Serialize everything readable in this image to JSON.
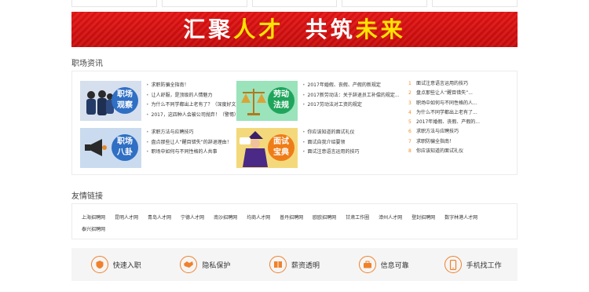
{
  "banner": {
    "part1": "汇聚",
    "part2": "人才",
    "part3": "共筑",
    "part4": "未来"
  },
  "career_news": {
    "title": "职场资讯",
    "blocks": [
      {
        "tag": "职场观察",
        "tag_line1": "职场",
        "tag_line2": "观察",
        "color": "#2f6fc4",
        "items": [
          "求职防骗全指南！",
          "让人舒服，是顶级的人情魅力",
          "为什么不同学都出上老有了？（深度好文）",
          "2017，这四种人会被公司抛弃！（警惕）"
        ]
      },
      {
        "tag": "劳动法规",
        "tag_line1": "劳动",
        "tag_line2": "法规",
        "color": "#1fa55b",
        "items": [
          "2017年婚假、丧假、产假的新规定",
          "2017新劳动法：关于辞退员工补偿的规定...",
          "2017劳动法对工资的规定"
        ]
      },
      {
        "tag": "职场八卦",
        "tag_line1": "职场",
        "tag_line2": "八卦",
        "color": "#2f6fc4",
        "items": [
          "求职方法与应聘技巧",
          "盘点那些让人“醒目错失”的辞退理由！",
          "职场中如何与不同性格的人共事"
        ]
      },
      {
        "tag": "面试宝典",
        "tag_line1": "面试",
        "tag_line2": "宝典",
        "color": "#ef7d17",
        "items": [
          "你应该知道的面试礼仪",
          "面试自我介绍要领",
          "面试注意语言运用的技巧"
        ]
      }
    ],
    "ranking": [
      "面试注意语言运用的技巧",
      "盘点那些让人“醒目错失”...",
      "职场中如何与不同性格的人...",
      "为什么不同学都出上老有了...",
      "2017年婚假、丧假、产假的...",
      "求职方法与应聘技巧",
      "求职防骗全指南！",
      "你应该知道的面试礼仪"
    ]
  },
  "friend_links": {
    "title": "友情链接",
    "row1": [
      "上海招聘网",
      "昆明人才网",
      "青岛人才网",
      "宁德人才网",
      "南沙招聘网",
      "均商人才网",
      "普丹招聘网",
      "欧欧招聘网",
      "甘肃工作圈",
      "漳州人才网",
      "登封招聘网",
      "数字林港人才网"
    ],
    "row2": [
      "泰兴招聘网"
    ]
  },
  "features": [
    {
      "label": "快速入职",
      "icon": "shield-icon"
    },
    {
      "label": "隐私保护",
      "icon": "handshake-icon"
    },
    {
      "label": "薪资透明",
      "icon": "book-icon"
    },
    {
      "label": "信息可靠",
      "icon": "briefcase-icon"
    },
    {
      "label": "手机找工作",
      "icon": "phone-icon"
    }
  ]
}
